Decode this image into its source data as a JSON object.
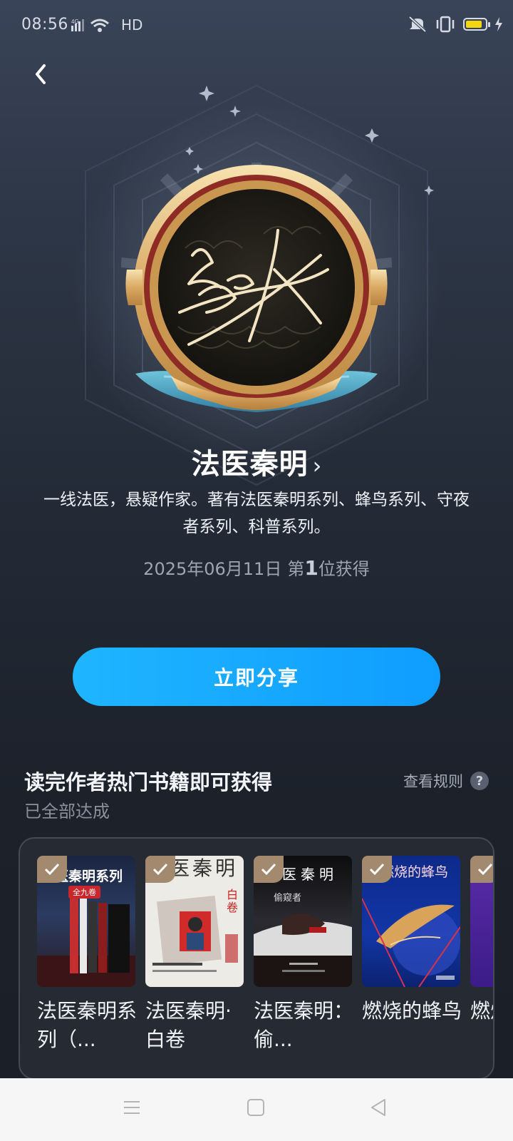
{
  "status_bar": {
    "time": "08:56",
    "network": "HD"
  },
  "badge": {
    "author": "法医秦明",
    "description": "一线法医，悬疑作家。著有法医秦明系列、蜂鸟系列、守夜者系列、科普系列。",
    "date": "2025年06月11日",
    "rank_prefix": "第",
    "rank": "1",
    "rank_suffix": "位获得"
  },
  "share_button": "立即分享",
  "section": {
    "title": "读完作者热门书籍即可获得",
    "subtitle": "已全部达成",
    "rules": "查看规则",
    "books": [
      {
        "title": "法医秦明系列（...",
        "cover_text": "法医秦明系列",
        "cover_badge": "全九卷"
      },
      {
        "title": "法医秦明·白卷",
        "cover_text": "医秦明",
        "cover_badge": "白卷"
      },
      {
        "title": "法医秦明：偷...",
        "cover_text": "医秦明",
        "cover_badge": "偷窥者"
      },
      {
        "title": "燃烧的蜂鸟",
        "cover_text": "燃烧的蜂鸟",
        "cover_badge": ""
      },
      {
        "title": "燃烧的蜂鸟",
        "cover_text": "",
        "cover_badge": ""
      }
    ]
  },
  "colors": {
    "accent": "#1aa8ff",
    "check": "#a3896e",
    "background": "#232a36"
  }
}
